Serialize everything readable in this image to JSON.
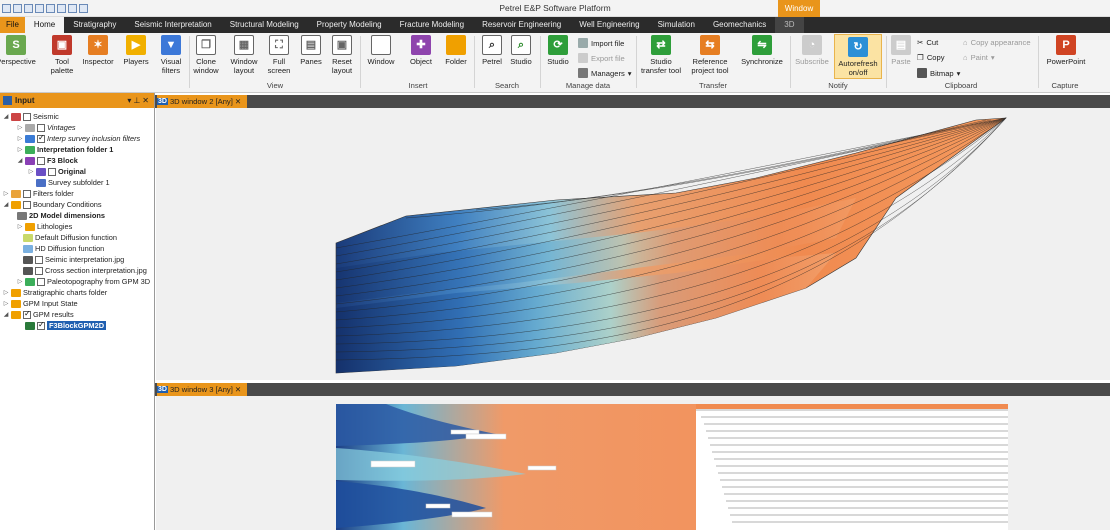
{
  "window": {
    "title": "Petrel E&P Software Platform",
    "context_tab": "Window"
  },
  "tabs": [
    {
      "label": "File"
    },
    {
      "label": "Home"
    },
    {
      "label": "Stratigraphy"
    },
    {
      "label": "Seismic Interpretation"
    },
    {
      "label": "Structural Modeling"
    },
    {
      "label": "Property Modeling"
    },
    {
      "label": "Fracture Modeling"
    },
    {
      "label": "Reservoir Engineering"
    },
    {
      "label": "Well Engineering"
    },
    {
      "label": "Simulation"
    },
    {
      "label": "Geomechanics"
    },
    {
      "label": "3D"
    }
  ],
  "ribbon": {
    "perspective": "Perspective",
    "tool_palette": [
      "Tool",
      "palette"
    ],
    "inspector": "Inspector",
    "players": "Players",
    "visual_filters": [
      "Visual",
      "filters"
    ],
    "clone_window": [
      "Clone",
      "window"
    ],
    "window_layout": [
      "Window",
      "layout"
    ],
    "full_screen": [
      "Full",
      "screen"
    ],
    "panes": "Panes",
    "reset_layout": [
      "Reset",
      "layout"
    ],
    "window": "Window",
    "object": "Object",
    "folder": "Folder",
    "petrel": "Petrel",
    "studio_search": "Studio",
    "studio_manage": "Studio",
    "import_file": "Import file",
    "export_file": "Export file",
    "managers": "Managers",
    "studio_transfer_tool": [
      "Studio",
      "transfer tool"
    ],
    "reference_project_tool": [
      "Reference",
      "project tool"
    ],
    "synchronize": "Synchronize",
    "subscribe": "Subscribe",
    "autorefresh": [
      "Autorefresh",
      "on/off"
    ],
    "paste": "Paste",
    "cut": "Cut",
    "copy": "Copy",
    "bitmap": "Bitmap",
    "copy_appearance": "Copy appearance",
    "paint": "Paint",
    "powerpoint": "PowerPoint",
    "groups": {
      "view": "View",
      "insert": "Insert",
      "search": "Search",
      "manage_data": "Manage data",
      "transfer": "Transfer",
      "notify": "Notify",
      "clipboard": "Clipboard",
      "capture": "Capture"
    }
  },
  "input_panel": {
    "title": "Input",
    "items": [
      {
        "label": "Seismic"
      },
      {
        "label": "Vintages"
      },
      {
        "label": "Interp survey inclusion filters"
      },
      {
        "label": "Interpretation folder 1"
      },
      {
        "label": "F3 Block"
      },
      {
        "label": "Original"
      },
      {
        "label": "Survey subfolder 1"
      },
      {
        "label": "Filters folder"
      },
      {
        "label": "Boundary Conditions"
      },
      {
        "label": "2D Model dimensions"
      },
      {
        "label": "Lithologies"
      },
      {
        "label": "Default Diffusion function"
      },
      {
        "label": "HD Diffusion function"
      },
      {
        "label": "Seimic interpretation.jpg"
      },
      {
        "label": "Cross section interpretation.jpg"
      },
      {
        "label": "Paleotopography from GPM 3D"
      },
      {
        "label": "Stratigraphic charts folder"
      },
      {
        "label": "GPM Input State"
      },
      {
        "label": "GPM results"
      },
      {
        "label": "F3BlockGPM2D"
      }
    ]
  },
  "views": [
    {
      "tab_label": "3D window 2 [Any]",
      "badge": "3D"
    },
    {
      "tab_label": "3D window 3 [Any]",
      "badge": "3D"
    }
  ],
  "colors": {
    "accent": "#e9951b",
    "selection": "#1f5fb0"
  }
}
